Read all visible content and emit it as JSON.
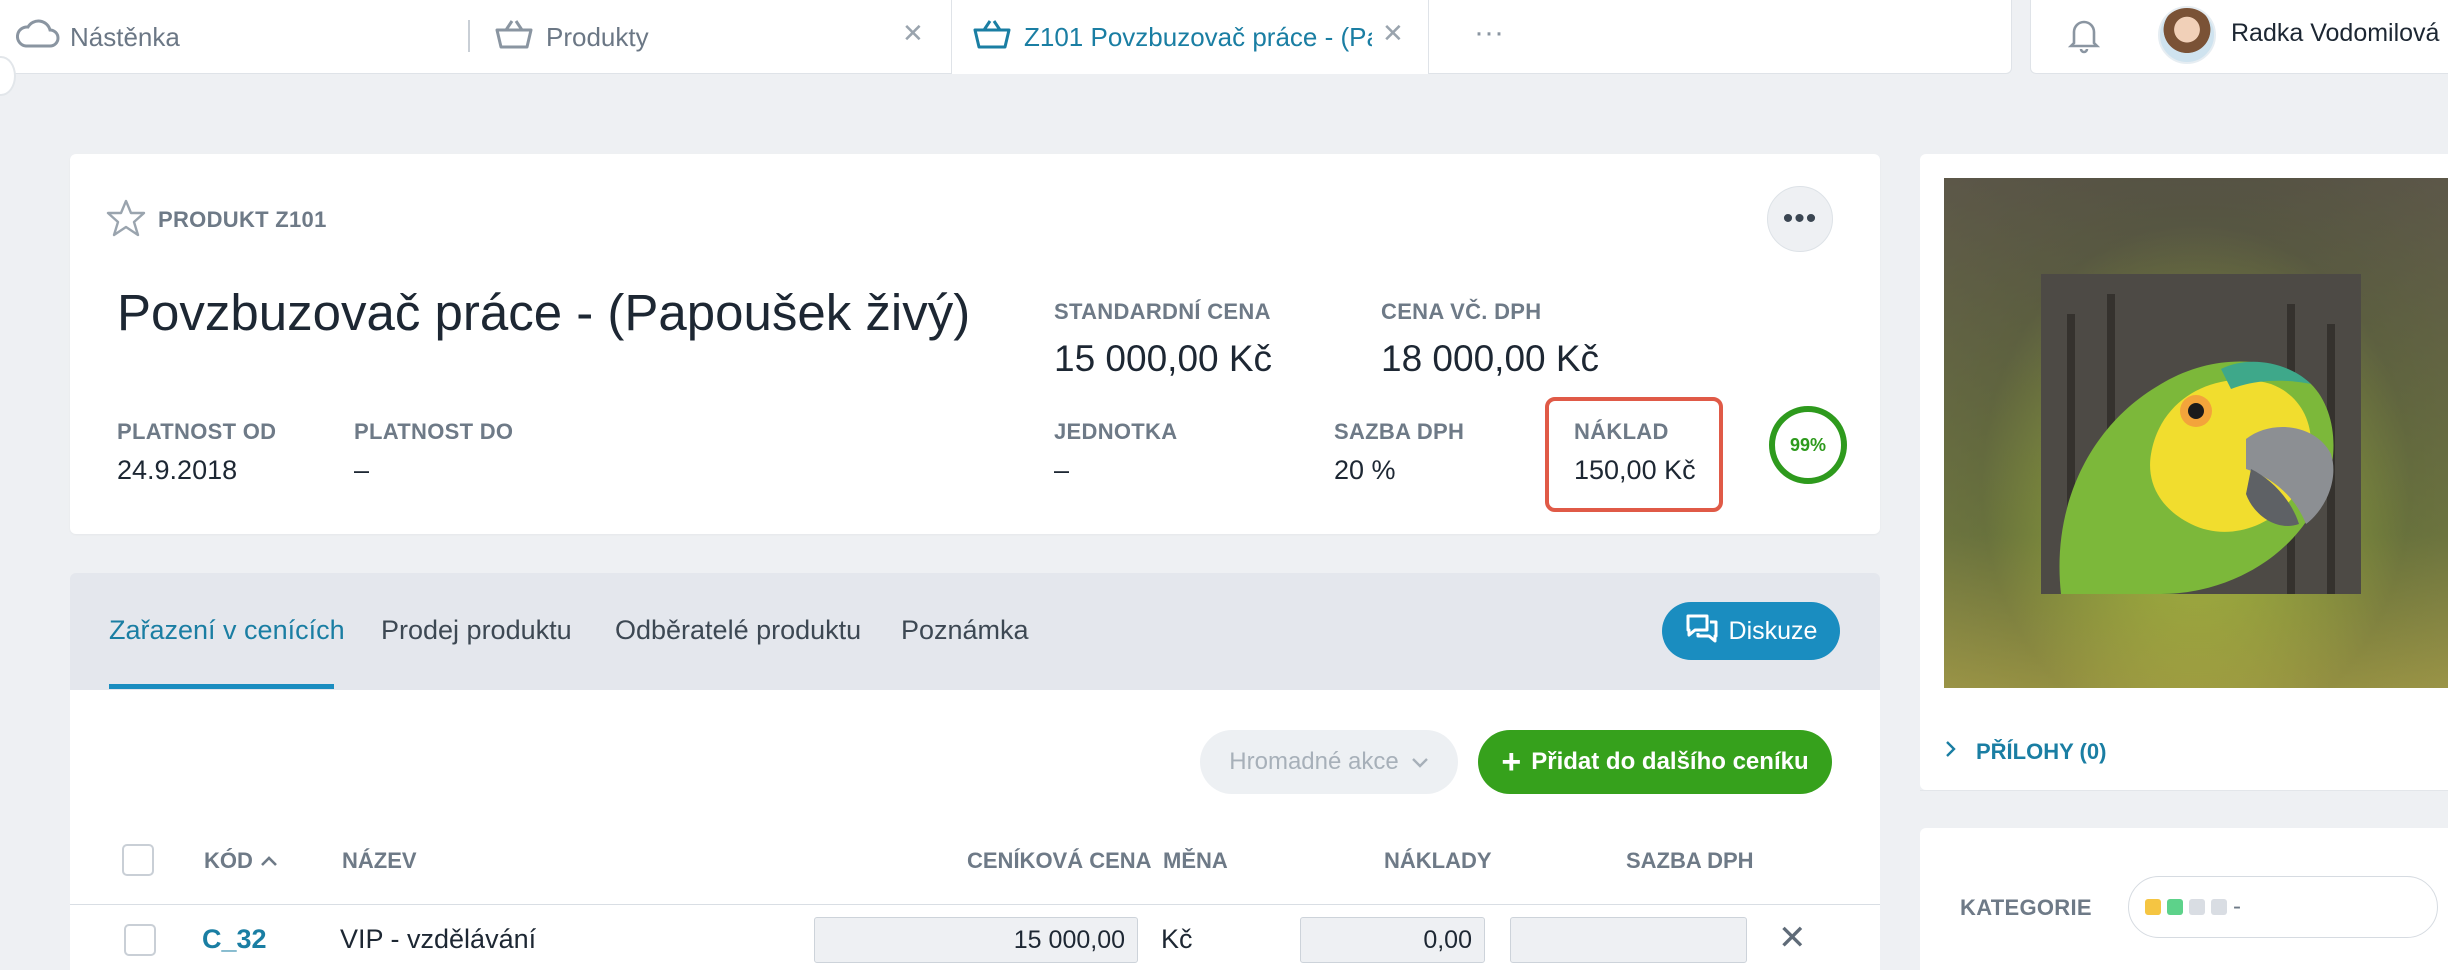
{
  "tabs": [
    {
      "label": "Nástěnka",
      "icon": "cloud-icon"
    },
    {
      "label": "Produkty",
      "icon": "basket-icon"
    },
    {
      "label": "Z101 Povzbuzovač práce - (Pa",
      "icon": "basket-icon"
    }
  ],
  "tab_more": "···",
  "user": {
    "name": "Radka Vodomilová"
  },
  "product": {
    "header_label": "PRODUKT Z101",
    "title": "Povzbuzovač práce - (Papoušek živý)",
    "more": "•••",
    "standard_price_label": "STANDARDNÍ CENA",
    "standard_price": "15 000,00 Kč",
    "price_vat_label": "CENA VČ. DPH",
    "price_vat": "18 000,00 Kč",
    "valid_from_label": "PLATNOST OD",
    "valid_from": "24.9.2018",
    "valid_to_label": "PLATNOST DO",
    "valid_to": "–",
    "unit_label": "JEDNOTKA",
    "unit": "–",
    "vat_rate_label": "SAZBA DPH",
    "vat_rate": "20 %",
    "cost_label": "NÁKLAD",
    "cost": "150,00 Kč",
    "margin": "99%"
  },
  "subtabs": [
    "Zařazení v cenících",
    "Prodej produktu",
    "Odběratelé produktu",
    "Poznámka"
  ],
  "diskuze": "Diskuze",
  "bulk_actions": "Hromadné akce",
  "add_button": "Přidat do dalšího ceníku",
  "table": {
    "headers": {
      "code": "KÓD",
      "name": "NÁZEV",
      "price": "CENÍKOVÁ CENA",
      "currency": "MĚNA",
      "cost": "NÁKLADY",
      "vat": "SAZBA DPH"
    },
    "rows": [
      {
        "code": "C_32",
        "name": "VIP - vzdělávání",
        "price": "15 000,00",
        "currency": "Kč",
        "cost": "0,00",
        "vat": ""
      }
    ]
  },
  "sidebar": {
    "attachments": "PŘÍLOHY (0)",
    "category_label": "KATEGORIE",
    "category_value": "-",
    "category_colors": [
      "#f5c542",
      "#5dd28a",
      "#d9dde3",
      "#d9dde3"
    ]
  },
  "colors": {
    "accent": "#1a8dc0",
    "green": "#36a11c",
    "highlight": "#e05a47"
  }
}
